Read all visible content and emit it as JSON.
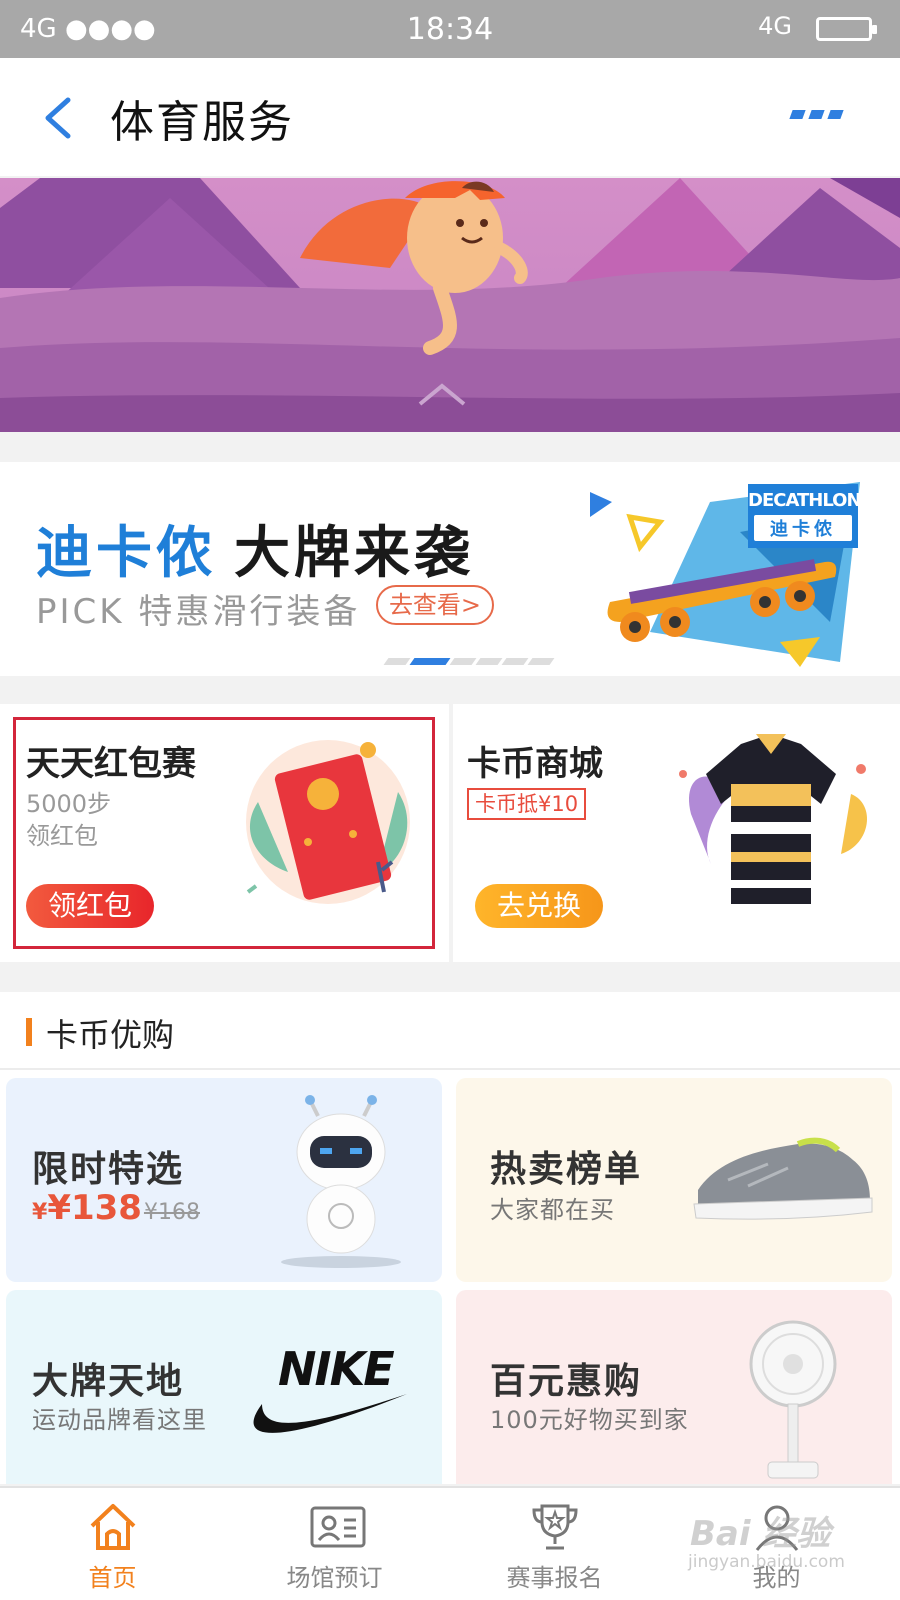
{
  "status_bar": {
    "signal": "4G ●●●●",
    "time": "18:34",
    "network": "4G"
  },
  "header": {
    "title": "体育服务"
  },
  "ad_banner": {
    "headline_blue": "迪卡侬",
    "headline_dark": "大牌来袭",
    "subline": "PICK 特惠滑行装备",
    "cta": "去查看>",
    "brand_en": "DECATHLON",
    "brand_cn": "迪卡侬",
    "active_slide": 2,
    "slide_count": 6
  },
  "promo_cards": [
    {
      "title": "天天红包赛",
      "line1": "5000步",
      "line2": "领红包",
      "button": "领红包"
    },
    {
      "title": "卡币商城",
      "tag": "卡币抵¥10",
      "button": "去兑换"
    }
  ],
  "section": {
    "title": "卡币优购"
  },
  "products": [
    {
      "title": "限时特选",
      "price": "¥138",
      "old_price": "¥168"
    },
    {
      "title": "热卖榜单",
      "subtitle": "大家都在买"
    },
    {
      "title": "大牌天地",
      "subtitle": "运动品牌看这里",
      "logo": "NIKE"
    },
    {
      "title": "百元惠购",
      "subtitle": "100元好物买到家"
    }
  ],
  "tab_bar": [
    {
      "label": "首页",
      "icon": "home-icon",
      "active": true
    },
    {
      "label": "场馆预订",
      "icon": "id-card-icon"
    },
    {
      "label": "赛事报名",
      "icon": "trophy-icon"
    },
    {
      "label": "我的",
      "icon": "person-icon"
    }
  ],
  "watermark": {
    "brand": "Bai 经验",
    "url": "jingyan.baidu.com"
  },
  "colors": {
    "accent": "#f2811d",
    "link": "#1f7fd8",
    "highlight_frame": "#d3263b"
  }
}
